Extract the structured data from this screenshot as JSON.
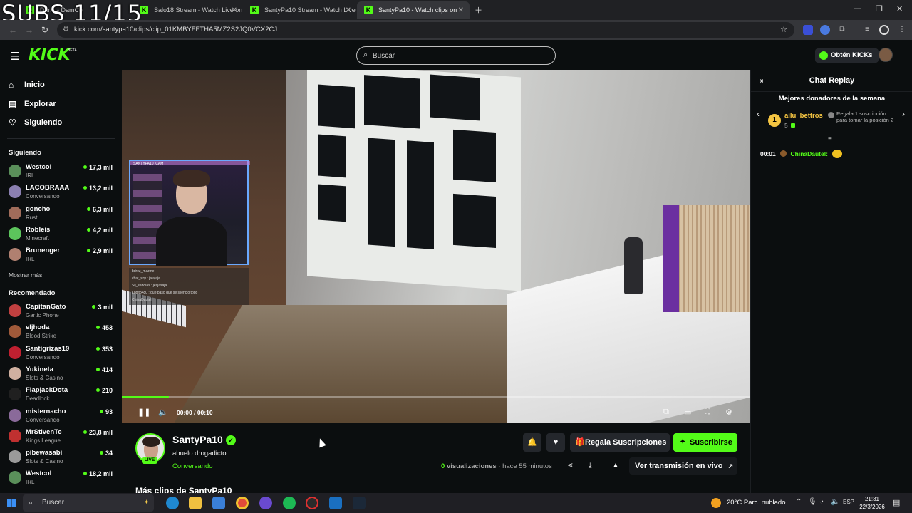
{
  "overlay_text": "SUBS 11/15",
  "browser": {
    "tabs": [
      {
        "label": "Dar... - DamCo",
        "active": false
      },
      {
        "label": "Salo18 Stream - Watch Live on",
        "active": false
      },
      {
        "label": "SantyPa10 Stream - Watch Live",
        "active": false
      },
      {
        "label": "SantyPa10 - Watch clips on",
        "active": true
      }
    ],
    "url": "kick.com/santypa10/clips/clip_01KMBYFFTHA5MZ2S2JQ0VCX2CJ"
  },
  "header": {
    "logo": "KICK",
    "logo_badge": "BETA",
    "search_placeholder": "Buscar",
    "kicks_button": "Obtén KICKs"
  },
  "sidebar": {
    "nav": [
      {
        "label": "Inicio",
        "icon": "home-icon"
      },
      {
        "label": "Explorar",
        "icon": "compass-icon"
      },
      {
        "label": "Siguiendo",
        "icon": "heart-icon"
      }
    ],
    "following_title": "Siguiendo",
    "following": [
      {
        "name": "Westcol",
        "category": "IRL",
        "viewers": "17,3 mil",
        "color": "#5a8f5a"
      },
      {
        "name": "LACOBRAAA",
        "category": "Conversando",
        "viewers": "13,2 mil",
        "color": "#8a7fb0"
      },
      {
        "name": "goncho",
        "category": "Rust",
        "viewers": "6,3 mil",
        "color": "#a06c5a"
      },
      {
        "name": "Robleis",
        "category": "Minecraft",
        "viewers": "4,2 mil",
        "color": "#5cc45c"
      },
      {
        "name": "Brunenger",
        "category": "IRL",
        "viewers": "2,9 mil",
        "color": "#b08070"
      }
    ],
    "show_more": "Mostrar más",
    "recommended_title": "Recomendado",
    "recommended": [
      {
        "name": "CapitanGato",
        "category": "Gartic Phone",
        "viewers": "3 mil",
        "color": "#c04040"
      },
      {
        "name": "eljhoda",
        "category": "Blood Strike",
        "viewers": "453",
        "color": "#a05a3a"
      },
      {
        "name": "Santigrizas19",
        "category": "Conversando",
        "viewers": "353",
        "color": "#c02030"
      },
      {
        "name": "Yukineta",
        "category": "Slots & Casino",
        "viewers": "414",
        "color": "#d0b0a0"
      },
      {
        "name": "FlapjackDota",
        "category": "Deadlock",
        "viewers": "210",
        "color": "#202020"
      },
      {
        "name": "misternacho",
        "category": "Conversando",
        "viewers": "93",
        "color": "#8a6a9a"
      },
      {
        "name": "MrStivenTc",
        "category": "Kings League",
        "viewers": "23,8 mil",
        "color": "#c03030"
      },
      {
        "name": "pibewasabi",
        "category": "Slots & Casino",
        "viewers": "34",
        "color": "#9a9a9a"
      },
      {
        "name": "Westcol",
        "category": "IRL",
        "viewers": "18,2 mil",
        "color": "#5a8f5a"
      }
    ]
  },
  "video": {
    "time": "00:00 / 00:10",
    "progress": 0.075,
    "webcam_label": "SANTYPA10_CAM",
    "overlay_chat": [
      "bdrez_mazine",
      "chat_soy : jajajaja",
      "Sil_sandias : jesjasaja",
      "Lobito480 : que paso que se silencio todo",
      "ChinaDautel"
    ]
  },
  "clip_info": {
    "channel": "SantyPa10",
    "live_badge": "LIVE",
    "title": "abuelo drogadicto",
    "category": "Conversando",
    "gift_button": "Regala Suscripciones",
    "subscribe_button": "Suscribirse",
    "views_count": "0",
    "views_label": "visualizaciones",
    "time_ago": "· hace 55 minutos",
    "live_button": "Ver transmisión en vivo",
    "more_clips": "Más clips de SantyPa10"
  },
  "chat": {
    "title": "Chat Replay",
    "donors_title": "Mejores donadores de la semana",
    "donor": {
      "rank": "1",
      "name": "ailu_bettros",
      "count": "5",
      "message": "Regala 1 suscripción para tomar la posición 2"
    },
    "messages": [
      {
        "time": "00:01",
        "user": "ChinaDautel:"
      }
    ]
  },
  "taskbar": {
    "search": "Buscar",
    "weather": "20°C  Parc. nublado",
    "lang": "ESP",
    "time": "21:31",
    "date": "22/3/2026"
  }
}
